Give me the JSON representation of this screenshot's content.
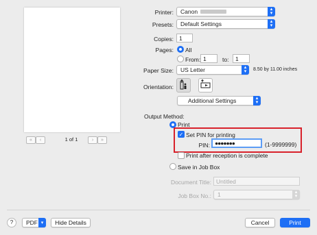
{
  "preview": {
    "page_indicator": "1 of 1",
    "first_label": "«",
    "prev_label": "‹",
    "next_label": "›",
    "last_label": "»"
  },
  "printer": {
    "label": "Printer:",
    "value": "Canon"
  },
  "presets": {
    "label": "Presets:",
    "value": "Default Settings"
  },
  "copies": {
    "label": "Copies:",
    "value": "1"
  },
  "pages": {
    "label": "Pages:",
    "all_label": "All",
    "from_label": "From:",
    "from_value": "1",
    "to_label": "to:",
    "to_value": "1"
  },
  "paper_size": {
    "label": "Paper Size:",
    "value": "US Letter",
    "dimensions": "8.50 by 11.00 inches"
  },
  "orientation": {
    "label": "Orientation:"
  },
  "section_popup": {
    "value": "Additional Settings"
  },
  "output_method": {
    "label": "Output Method:",
    "print_label": "Print",
    "set_pin_label": "Set PIN for printing",
    "pin_label": "PIN:",
    "pin_value": "●●●●●●●",
    "pin_range": "(1-9999999)",
    "print_after_label": "Print after reception is complete",
    "save_job_box_label": "Save in Job Box",
    "document_title_label": "Document Title:",
    "document_title_value": "Untitled",
    "job_box_label": "Job Box No.:",
    "job_box_value": "1"
  },
  "footer": {
    "help_label": "?",
    "pdf_label": "PDF",
    "hide_details_label": "Hide Details",
    "cancel_label": "Cancel",
    "print_label": "Print"
  },
  "colors": {
    "accent": "#1e6ff5",
    "highlight": "#d8202a"
  }
}
